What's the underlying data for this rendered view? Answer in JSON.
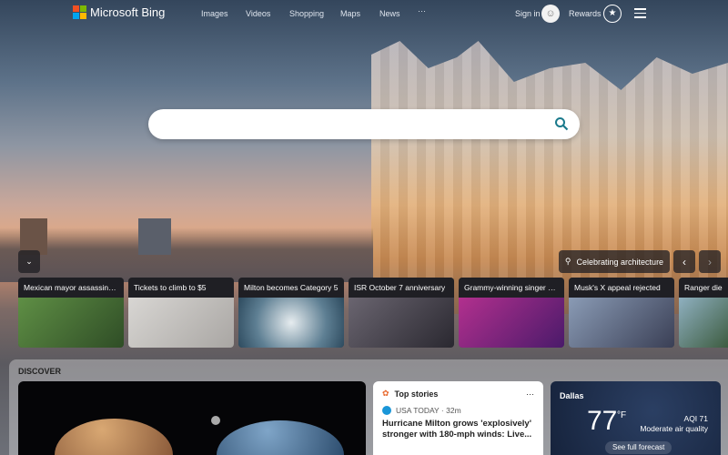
{
  "header": {
    "brand": "Microsoft Bing",
    "links": [
      "Images",
      "Videos",
      "Shopping",
      "Maps",
      "News"
    ],
    "more": "···",
    "sign_in": "Sign in",
    "rewards": "Rewards"
  },
  "search": {
    "placeholder": "",
    "value": ""
  },
  "hero": {
    "caption": "Celebrating architecture"
  },
  "news_cards": [
    {
      "title": "Mexican mayor assassina...",
      "color": "#4b7a3a"
    },
    {
      "title": "Tickets to climb to $5",
      "color": "#b9b7b5"
    },
    {
      "title": "Milton becomes Category 5",
      "color": "#6d8a9e"
    },
    {
      "title": "ISR October 7 anniversary",
      "color": "#3d3a40"
    },
    {
      "title": "Grammy-winning singer dies",
      "color": "#8a2d7a"
    },
    {
      "title": "Musk's X appeal rejected",
      "color": "#6e7c96"
    },
    {
      "title": "Ranger die",
      "color": "#5d7a60"
    }
  ],
  "discover": {
    "title": "DISCOVER"
  },
  "top_stories": {
    "title": "Top stories",
    "more": "···",
    "source": "USA TODAY · 32m",
    "headline": "Hurricane Milton grows 'explosively' stronger with 180-mph winds: Live..."
  },
  "weather": {
    "city": "Dallas",
    "temp": "77",
    "unit": "°F",
    "aqi": "AQI 71",
    "air": "Moderate air quality",
    "forecast": "See full forecast"
  }
}
